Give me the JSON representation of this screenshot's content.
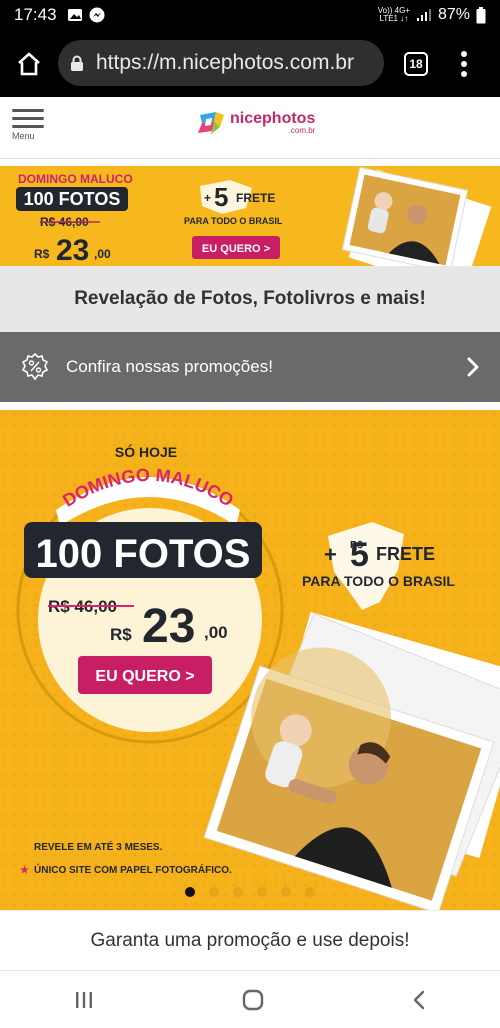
{
  "status": {
    "time": "17:43",
    "net_top": "Vo)) 4G+",
    "net_bottom": "LTE1 ↓↑",
    "battery": "87%"
  },
  "browser": {
    "url": "https://m.nicephotos.com.br",
    "tab_count": "18"
  },
  "header": {
    "menu_label": "Menu",
    "logo_text": "nicephotos",
    "logo_sub": ".com.br"
  },
  "strip_banner": {
    "tag": "DOMINGO MALUCO",
    "headline": "100 FOTOS",
    "old_price": "R$ 46,00",
    "currency": "R$",
    "price": "23",
    "cents": ",00",
    "frete_plus": "+",
    "frete_num": "5",
    "frete_word": "FRETE",
    "frete_sub": "PARA TODO O BRASIL",
    "cta": "EU QUERO >"
  },
  "tagline": "Revelação de Fotos, Fotolivros e mais!",
  "promo_bar": {
    "text": "Confira nossas promoções!"
  },
  "hero": {
    "so_hoje": "SÓ HOJE",
    "arc_text": "DOMINGO MALUCO",
    "headline": "100 FOTOS",
    "old_price": "R$ 46,00",
    "currency": "R$",
    "price": "23",
    "cents": ",00",
    "cta": "EU QUERO >",
    "frete_plus": "+",
    "frete_cur": "R$",
    "frete_num": "5",
    "frete_word": "FRETE",
    "frete_sub": "PARA TODO O BRASIL",
    "note1": "REVELE EM ATÉ 3 MESES.",
    "note2": "ÚNICO SITE COM PAPEL FOTOGRÁFICO.",
    "dots": 6,
    "active_dot": 0
  },
  "footer_text": "Garanta uma promoção e use depois!",
  "colors": {
    "brand_pink": "#c4286a",
    "banner_yellow": "#f6b21b",
    "dark_navy": "#22272f"
  }
}
